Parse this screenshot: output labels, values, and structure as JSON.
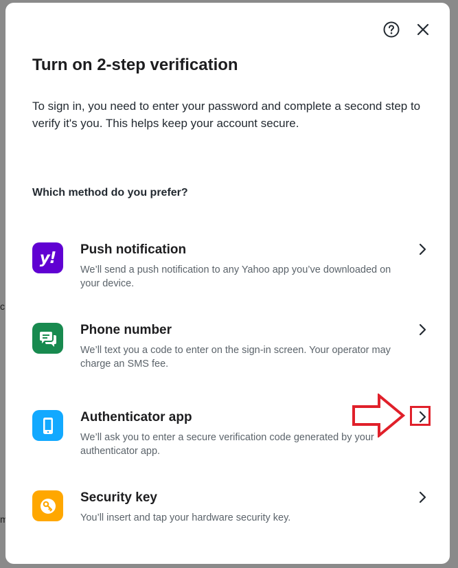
{
  "background": {
    "fragments": [
      "c",
      "m"
    ]
  },
  "header": {
    "help_icon": "help-circle-icon",
    "close_icon": "close-icon"
  },
  "title": "Turn on 2-step verification",
  "description": "To sign in, you need to enter your password and complete a second step to verify it's you. This helps keep your account secure.",
  "question": "Which method do you prefer?",
  "methods": [
    {
      "title": "Push notification",
      "description": "We’ll send a push notification to any Yahoo app you’ve downloaded on your device.",
      "icon": "yahoo-logo-icon",
      "icon_glyph": "y!",
      "color": "#6001d2"
    },
    {
      "title": "Phone number",
      "description": "We’ll text you a code to enter on the sign-in screen. Your operator may charge an SMS fee.",
      "icon": "chat-bubble-icon",
      "color": "#188a4f"
    },
    {
      "title": "Authenticator app",
      "description": "We’ll ask you to enter a secure verification code generated by your authenticator app.",
      "icon": "smartphone-icon",
      "color": "#12a9ff"
    },
    {
      "title": "Security key",
      "description": "You’ll insert and tap your hardware security key.",
      "icon": "key-icon",
      "color": "#ffa700"
    }
  ],
  "annotation": {
    "color": "#e0202a"
  }
}
